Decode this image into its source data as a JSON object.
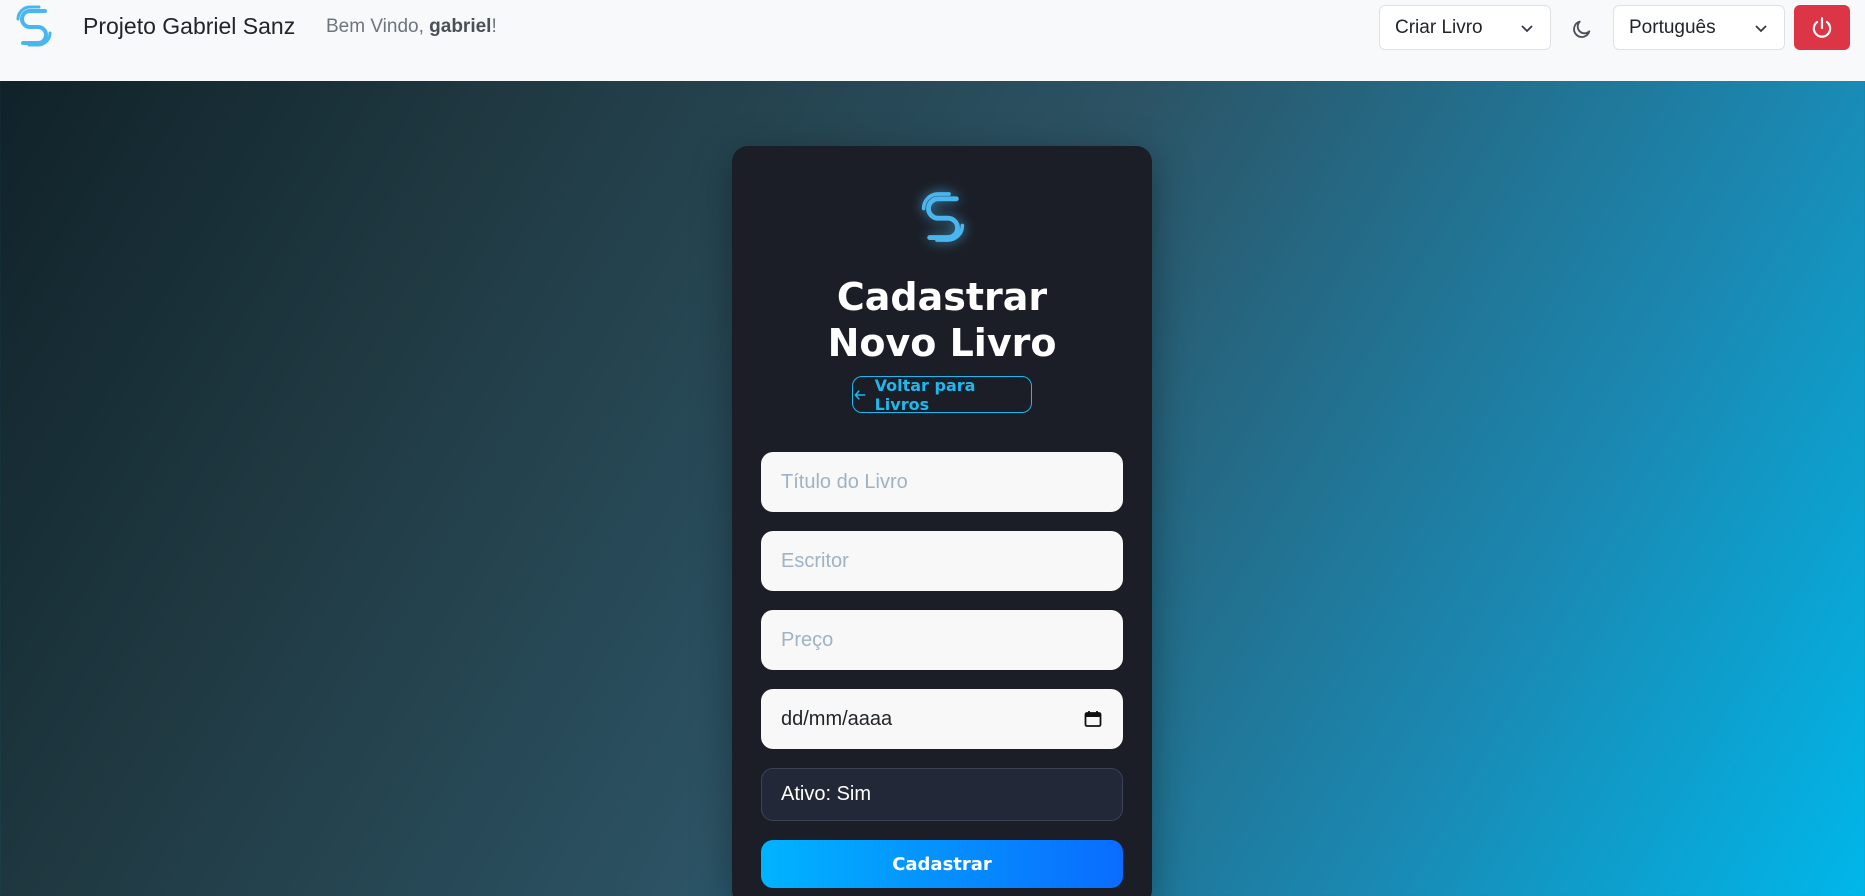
{
  "navbar": {
    "brand": "Projeto Gabriel Sanz",
    "welcome_prefix": "Bem Vindo, ",
    "welcome_user": "gabriel",
    "welcome_suffix": "!",
    "create_select_value": "Criar Livro",
    "language_select_value": "Português",
    "icons": {
      "logo": "s-logo-icon",
      "theme": "moon-icon",
      "logout": "power-icon",
      "dropdown": "chevron-down-icon"
    },
    "colors": {
      "logout_bg": "#dc3545",
      "logo": "#4ab6f0"
    }
  },
  "form": {
    "title": "Cadastrar Novo Livro",
    "back_label": "Voltar para Livros",
    "title_placeholder": "Título do Livro",
    "writer_placeholder": "Escritor",
    "price_placeholder": "Preço",
    "date_value": "dd/mm/aaaa",
    "active_label": "Ativo: Sim",
    "submit_label": "Cadastrar",
    "colors": {
      "accent": "#1cb8f0",
      "card_bg": "#1b1e26"
    }
  }
}
